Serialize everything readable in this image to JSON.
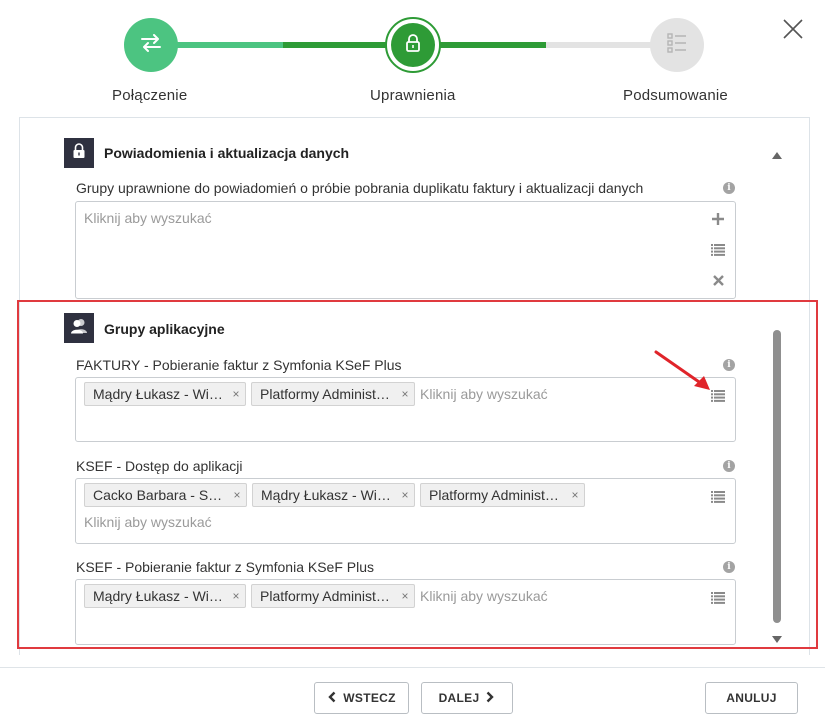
{
  "stepper": {
    "steps": [
      {
        "label": "Połączenie",
        "state": "done",
        "icon": "arrows-exchange-icon"
      },
      {
        "label": "Uprawnienia",
        "state": "active",
        "icon": "lock-icon"
      },
      {
        "label": "Podsumowanie",
        "state": "pending",
        "icon": "checklist-icon"
      }
    ],
    "colors": {
      "done": "#4cc481",
      "active": "#2e9b36",
      "pending": "#e3e3e3"
    }
  },
  "section_notifications": {
    "title": "Powiadomienia i aktualizacja danych",
    "icon": "lock-icon",
    "field_label": "Grupy uprawnione do powiadomień o próbie pobrania duplikatu faktury i aktualizacji danych",
    "placeholder": "Kliknij aby wyszukać"
  },
  "section_app_groups": {
    "title": "Grupy aplikacyjne",
    "icon": "users-icon",
    "fields": [
      {
        "label": "FAKTURY - Pobieranie faktur z Symfonia KSeF Plus",
        "tags": [
          "Mądry Łukasz - Wic…",
          "Platformy Administ…"
        ],
        "placeholder": "Kliknij aby wyszukać"
      },
      {
        "label": "KSEF - Dostęp do aplikacji",
        "tags": [
          "Cacko Barbara - Se…",
          "Mądry Łukasz - Wic…",
          "Platformy Administ…"
        ],
        "placeholder": "Kliknij aby wyszukać"
      },
      {
        "label": "KSEF - Pobieranie faktur z Symfonia KSeF Plus",
        "tags": [
          "Mądry Łukasz - Wic…",
          "Platformy Administ…"
        ],
        "placeholder": "Kliknij aby wyszukać"
      }
    ]
  },
  "footer": {
    "back_label": "WSTECZ",
    "next_label": "DALEJ",
    "cancel_label": "ANULUJ"
  },
  "colors": {
    "highlight": "#e03a3f",
    "annotation_arrow": "#e0242a",
    "section_icon_bg": "#2f3140"
  }
}
